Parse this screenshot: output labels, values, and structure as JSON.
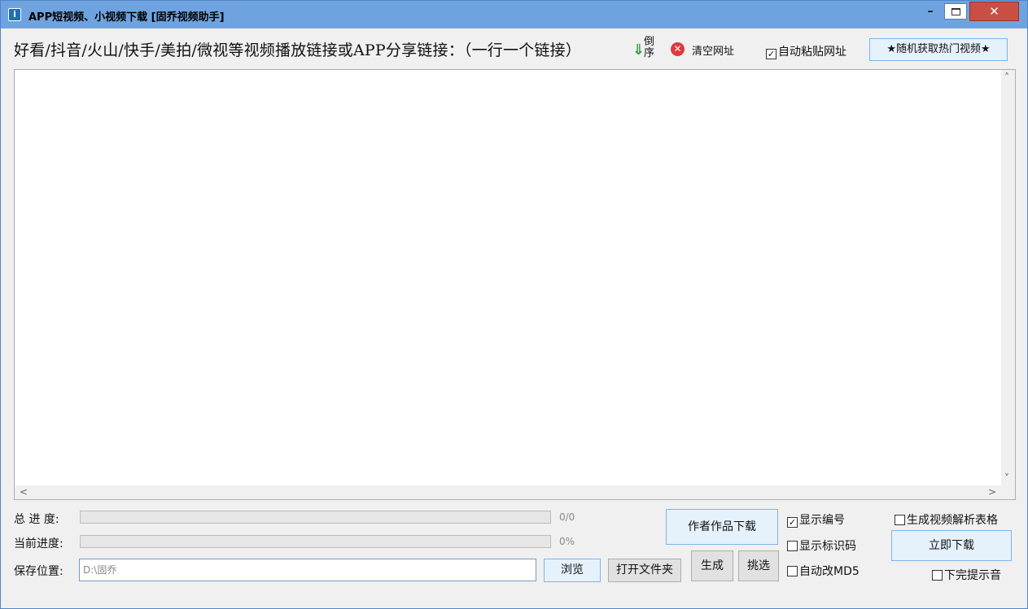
{
  "window": {
    "title": "APP短视频、小视频下载 [固乔视频助手]",
    "icon_glyph": "i",
    "minimize_glyph": "–",
    "close_glyph": "✕"
  },
  "toolbar": {
    "url_label": "好看/抖音/火山/快手/美拍/微视等视频播放链接或APP分享链接：（一行一个链接）",
    "reverse_arrow": "⇓",
    "reverse_label": "倒序",
    "clear_icon": "✕",
    "clear_label": "清空网址",
    "auto_paste_label": "自动粘贴网址",
    "auto_paste_checked": "✓",
    "random_hot_label": "★随机获取热门视频★"
  },
  "textarea": {
    "value": "",
    "scroll_up": "˄",
    "scroll_down": "˅",
    "scroll_left": "<",
    "scroll_right": ">"
  },
  "progress": {
    "total_label": "总 进 度:",
    "total_value": "0/0",
    "current_label": "当前进度:",
    "current_value": "0%",
    "total_fraction": 0,
    "current_fraction": 0
  },
  "save": {
    "label": "保存位置:",
    "path": "D:\\固乔",
    "browse_label": "浏览",
    "open_folder_label": "打开文件夹"
  },
  "actions": {
    "author_download_label": "作者作品下载",
    "generate_label": "生成",
    "select_label": "挑选",
    "download_now_label": "立即下载"
  },
  "options": {
    "show_number_label": "显示编号",
    "show_number_checked": "✓",
    "show_id_label": "显示标识码",
    "auto_md5_label": "自动改MD5",
    "gen_table_label": "生成视频解析表格",
    "sound_label": "下完提示音"
  }
}
